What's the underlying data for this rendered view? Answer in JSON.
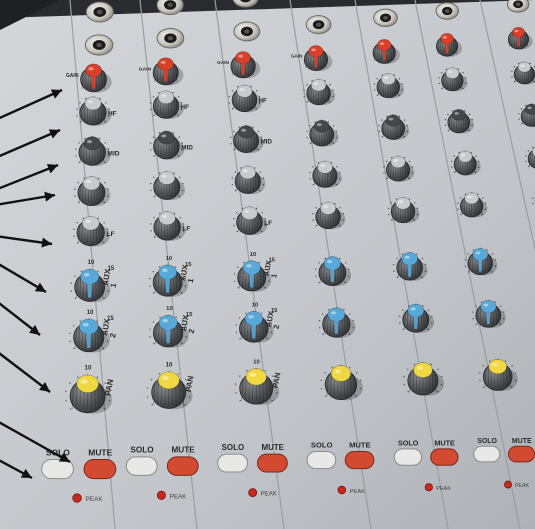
{
  "labels": {
    "gain": "GAIN",
    "hf": "HF",
    "mid": "MID",
    "lf": "LF",
    "aux": "AUX",
    "aux1_num": "1",
    "aux2_num": "2",
    "pan": "PAN",
    "solo": "SOLO",
    "mute": "MUTE",
    "peak": "PEAK"
  },
  "scale_marks": {
    "aux": [
      "10",
      "15"
    ],
    "pan": [
      "10"
    ]
  },
  "colors": {
    "panel": "#c9ccd0",
    "gain_cap": "#d8402a",
    "eq_cap": "#c8cbce",
    "mid_cap": "#45484b",
    "aux_cap": "#58a8d8",
    "pan_cap": "#f0d843",
    "solo_button": "#e8e8e6",
    "mute_button": "#d24a30",
    "peak_led": "#c8281e",
    "arrows": "#111111"
  },
  "channel_count": 7,
  "callout_arrow_count": 10
}
